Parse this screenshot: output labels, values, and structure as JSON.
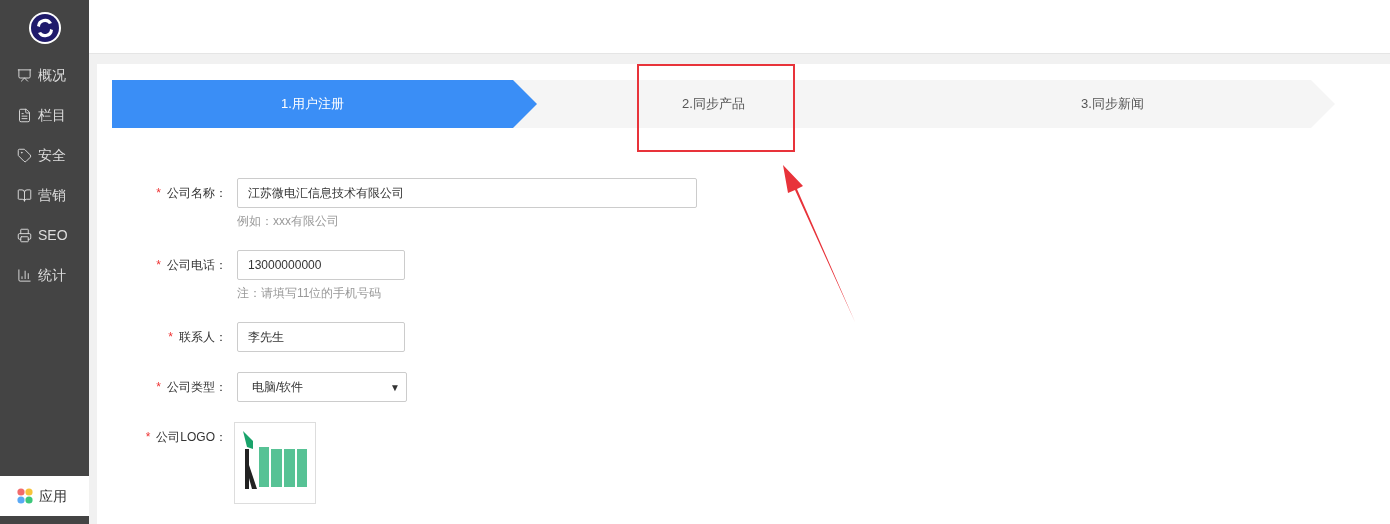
{
  "sidebar": {
    "items": [
      {
        "label": "概况",
        "selected": false
      },
      {
        "label": "栏目",
        "selected": false
      },
      {
        "label": "安全",
        "selected": false
      },
      {
        "label": "营销",
        "selected": false
      },
      {
        "label": "SEO",
        "selected": false
      },
      {
        "label": "统计",
        "selected": false
      }
    ],
    "bottom_item": {
      "label": "应用",
      "selected": true
    }
  },
  "steps": [
    {
      "label": "1.用户注册",
      "selected": true
    },
    {
      "label": "2.同步产品",
      "selected": false
    },
    {
      "label": "3.同步新闻",
      "selected": false
    }
  ],
  "form": {
    "fields": [
      {
        "kind": "text",
        "label": "公司名称：",
        "required": true,
        "value": "江苏微电汇信息技术有限公司",
        "hint": "例如：xxx有限公司",
        "wide": true
      },
      {
        "kind": "text",
        "label": "公司电话：",
        "required": true,
        "value": "13000000000",
        "hint": "注：请填写11位的手机号码",
        "wide": false
      },
      {
        "kind": "text",
        "label": "联系人：",
        "required": true,
        "value": "李先生",
        "wide": false
      },
      {
        "kind": "select",
        "label": "公司类型：",
        "required": true,
        "value": "电脑/软件",
        "arrow": "▼"
      },
      {
        "label": "公司LOGO：",
        "required": true
      }
    ],
    "required_mark": "*"
  }
}
